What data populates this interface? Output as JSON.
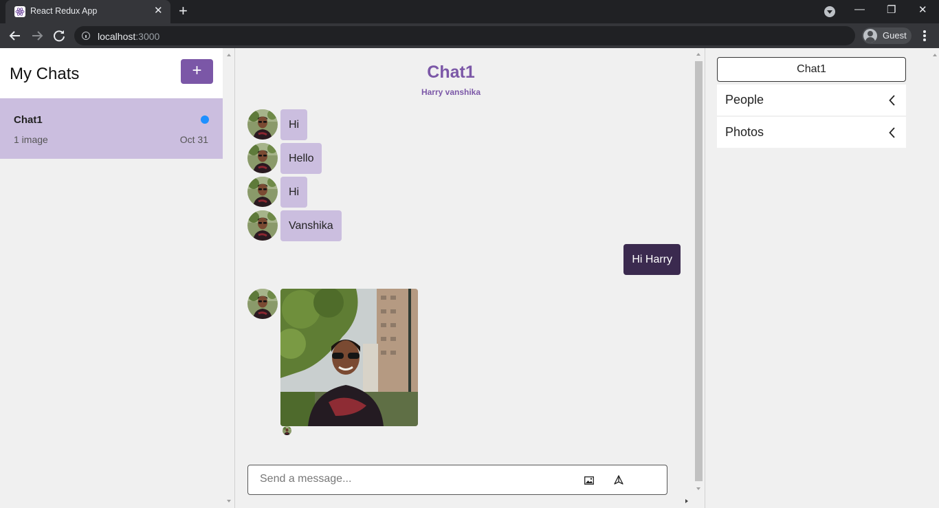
{
  "browser": {
    "tab_title": "React Redux App",
    "tab_close": "✕",
    "new_tab": "+",
    "url_host": "localhost",
    "url_port": ":3000",
    "profile_name": "Guest",
    "min": "—",
    "restore": "❐",
    "close": "✕"
  },
  "sidebar": {
    "title": "My Chats",
    "add_label": "+",
    "chats": [
      {
        "name": "Chat1",
        "subtitle": "1 image",
        "date": "Oct 31",
        "unread_color": "#1e90ff"
      }
    ]
  },
  "feed": {
    "title": "Chat1",
    "members": "Harry vanshika",
    "messages": [
      {
        "text": "Hi",
        "mine": false
      },
      {
        "text": "Hello",
        "mine": false
      },
      {
        "text": "Hi",
        "mine": false
      },
      {
        "text": "Vanshika",
        "mine": false
      },
      {
        "text": "Hi Harry",
        "mine": true
      },
      {
        "type": "image",
        "mine": false,
        "icon": "photo-of-man"
      }
    ],
    "composer": {
      "placeholder": "Send a message..."
    }
  },
  "settings": {
    "chat_title": "Chat1",
    "sections": [
      {
        "label": "People"
      },
      {
        "label": "Photos"
      }
    ]
  },
  "colors": {
    "brand": "#7b57a7",
    "bubble_other": "#cbbedf",
    "bubble_mine": "#3b2a4f",
    "background": "#f0f0f0"
  }
}
